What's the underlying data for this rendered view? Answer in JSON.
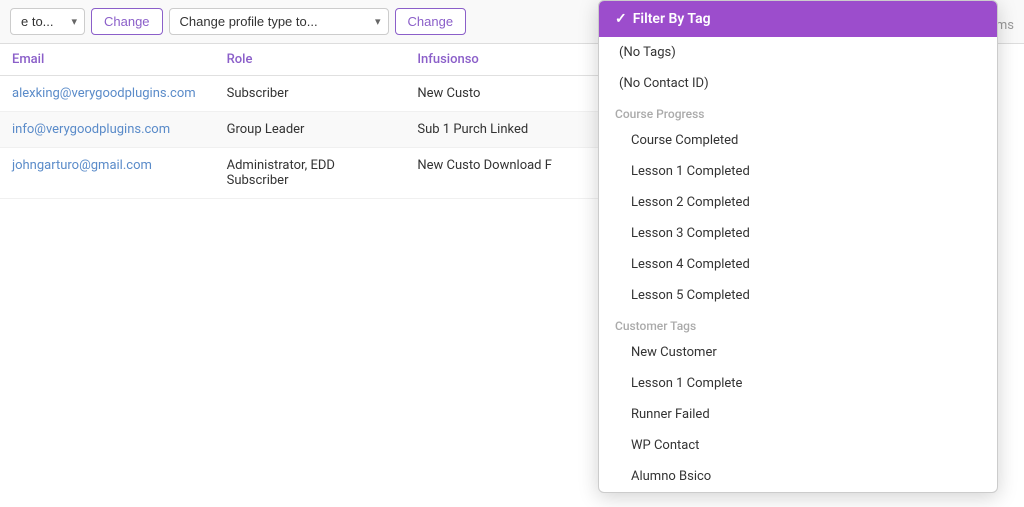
{
  "toolbar": {
    "select1_value": "e to...",
    "select1_placeholder": "e to...",
    "change_label_1": "Change",
    "select2_value": "Change profile type to...",
    "change_label_2": "Change",
    "right_hint": "ms"
  },
  "table": {
    "columns": [
      "Email",
      "Role",
      "Infusionso"
    ],
    "rows": [
      {
        "email": "alexking@verygoodplugins.com",
        "role": "Subscriber",
        "infusion": "New Custo"
      },
      {
        "email": "info@verygoodplugins.com",
        "role": "Group Leader",
        "infusion": "Sub 1 Purch Linked"
      },
      {
        "email": "johngarturo@gmail.com",
        "role": "Administrator, EDD Subscriber",
        "infusion": "New Custo Download F"
      }
    ]
  },
  "dropdown": {
    "header_icon": "✓",
    "header_label": "Filter By Tag",
    "items": [
      {
        "type": "item",
        "label": "(No Tags)"
      },
      {
        "type": "item",
        "label": "(No Contact ID)"
      },
      {
        "type": "section",
        "label": "Course Progress"
      },
      {
        "type": "item",
        "label": "Course Completed",
        "indented": true
      },
      {
        "type": "item",
        "label": "Lesson 1 Completed",
        "indented": true
      },
      {
        "type": "item",
        "label": "Lesson 2 Completed",
        "indented": true
      },
      {
        "type": "item",
        "label": "Lesson 3 Completed",
        "indented": true
      },
      {
        "type": "item",
        "label": "Lesson 4 Completed",
        "indented": true
      },
      {
        "type": "item",
        "label": "Lesson 5 Completed",
        "indented": true
      },
      {
        "type": "section",
        "label": "Customer Tags"
      },
      {
        "type": "item",
        "label": "New Customer",
        "indented": true
      },
      {
        "type": "item",
        "label": "Lesson 1 Complete",
        "indented": true
      },
      {
        "type": "item",
        "label": "Runner Failed",
        "indented": true
      },
      {
        "type": "item",
        "label": "WP Contact",
        "indented": true
      },
      {
        "type": "item",
        "label": "Alumno Bsico",
        "indented": true
      }
    ]
  }
}
